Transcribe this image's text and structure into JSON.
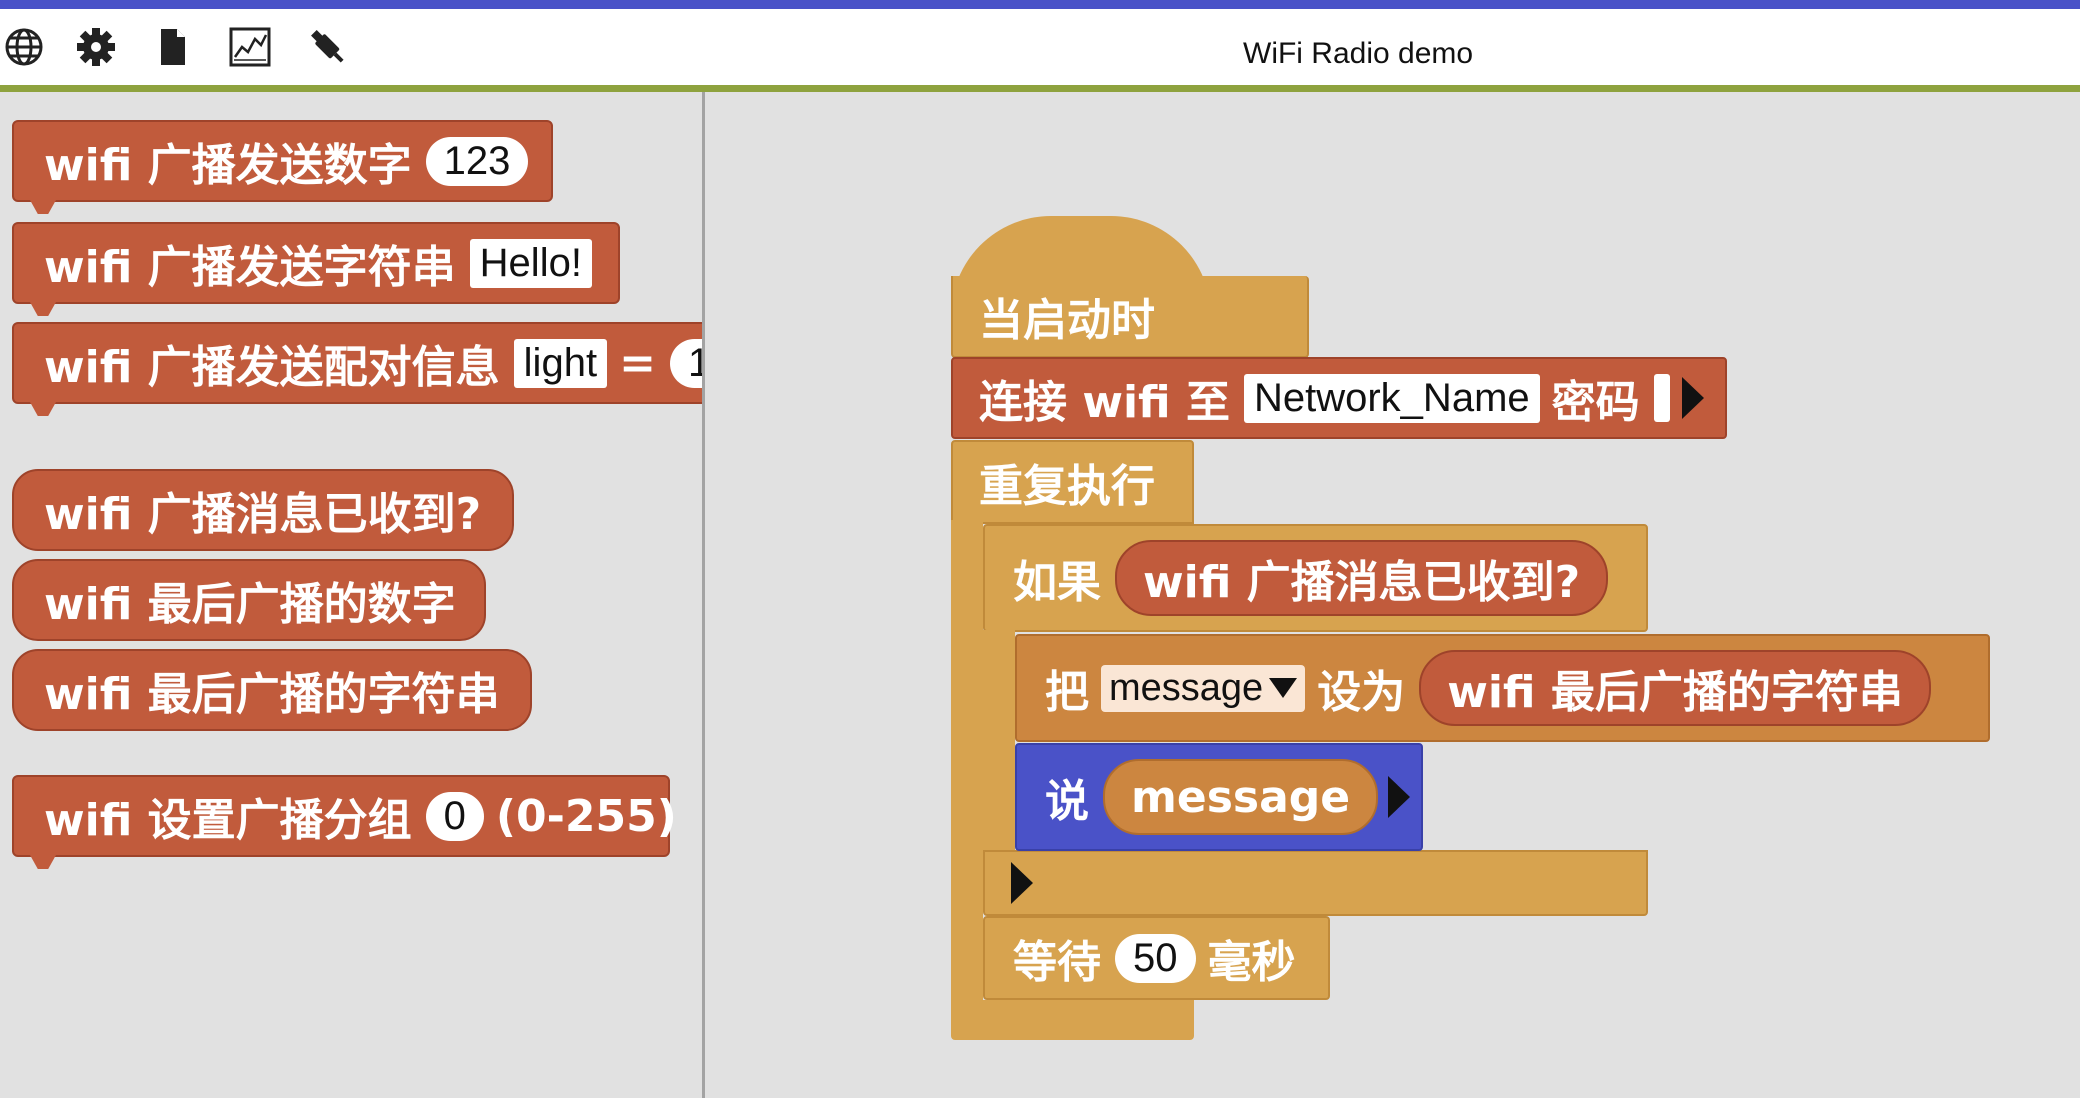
{
  "app": {
    "title": "WiFi Radio demo"
  },
  "toolbar": {
    "icons": [
      "globe-icon",
      "gear-icon",
      "file-icon",
      "chart-icon",
      "usb-icon"
    ]
  },
  "palette": {
    "send_number": {
      "label": "wifi 广播发送数字",
      "value": "123"
    },
    "send_string": {
      "label": "wifi 广播发送字符串",
      "value": "Hello!"
    },
    "send_pair": {
      "label": "wifi 广播发送配对信息",
      "key": "light",
      "eq": "=",
      "value": "1"
    },
    "received": {
      "label": "wifi 广播消息已收到?"
    },
    "last_number": {
      "label": "wifi 最后广播的数字"
    },
    "last_string": {
      "label": "wifi 最后广播的字符串"
    },
    "set_group": {
      "label": "wifi 设置广播分组",
      "value": "0",
      "range": "(0-255)"
    }
  },
  "script": {
    "hat": {
      "label": "当启动时"
    },
    "connect": {
      "label": "连接 wifi 至",
      "network": "Network_Name",
      "password_label": "密码",
      "password": ""
    },
    "forever": {
      "label": "重复执行"
    },
    "if_block": {
      "label": "如果",
      "condition": "wifi 广播消息已收到?"
    },
    "set_var": {
      "label": "把",
      "variable": "message",
      "to_label": "设为",
      "value": "wifi 最后广播的字符串"
    },
    "say": {
      "label": "说",
      "value": "message"
    },
    "wait": {
      "label": "等待",
      "value": "50",
      "unit": "毫秒"
    }
  },
  "colors": {
    "wifi": "#c15b3c",
    "control": "#d7a34f",
    "looks": "#4a52c8",
    "variables": "#cc8640",
    "toolbar_accent": "#8ea23e",
    "top_bar": "#4a52c8"
  }
}
